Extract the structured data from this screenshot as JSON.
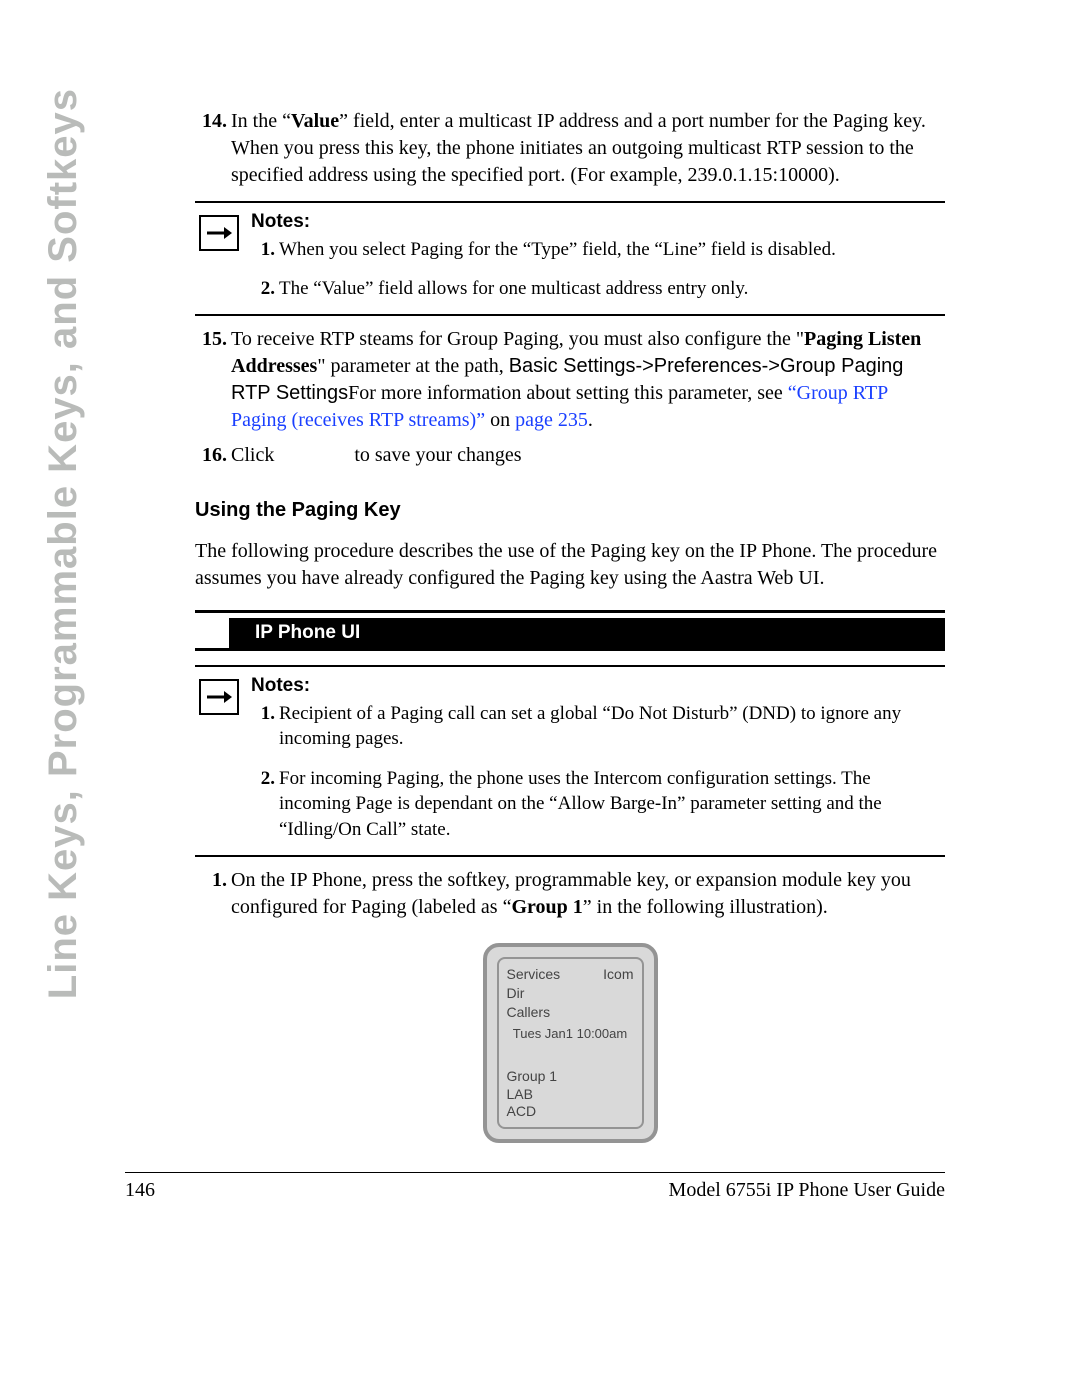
{
  "side_tab": "Line Keys, Programmable Keys, and Softkeys",
  "steps": {
    "s14": {
      "num": "14.",
      "pre": "In the “",
      "bold": "Value",
      "post": "” field, enter a multicast IP address and a port number for the Paging key. When you press this key, the phone initiates an outgoing multicast RTP session to the specified address using the specified port. (For example, 239.0.1.15:10000)."
    },
    "s15": {
      "num": "15.",
      "t1": "To receive RTP steams for Group Paging, you must also configure the \"",
      "b1": "Paging Listen Addresses",
      "t2": "\" parameter at the path, ",
      "sans": "Basic Settings->Preferences->Group Paging RTP Settings",
      "t3": "For more information about setting this parameter, see ",
      "link1": "“Group RTP Paging (receives RTP streams)”",
      "t4": " on ",
      "link2": "page 235",
      "t5": "."
    },
    "s16": {
      "num": "16.",
      "t1": "Click",
      "t2": "to save your changes"
    },
    "s1b": {
      "num": "1.",
      "t1": "On the IP Phone, press the softkey, programmable key, or expansion module key you configured for Paging (labeled as “",
      "b1": "Group 1",
      "t2": "” in the following illustration)."
    }
  },
  "notes1": {
    "title": "Notes:",
    "n1": {
      "num": "1.",
      "text": "When you select Paging for the “Type” field, the “Line” field is disabled."
    },
    "n2": {
      "num": "2.",
      "text": "The “Value” field allows for one multicast address entry only."
    }
  },
  "subhead": "Using the Paging Key",
  "para1": "The following procedure describes the use of the Paging key on the IP Phone. The procedure assumes you have already configured the Paging key using the Aastra Web UI.",
  "bar_label": "IP Phone UI",
  "notes2": {
    "title": "Notes:",
    "n1": {
      "num": "1.",
      "text": "Recipient of a Paging call can set a global “Do Not Disturb” (DND) to ignore any incoming pages."
    },
    "n2": {
      "num": "2.",
      "text": "For incoming Paging, the phone uses the Intercom configuration settings. The incoming Page is dependant on the “Allow Barge-In” parameter setting and the “Idling/On Call” state."
    }
  },
  "phone": {
    "services": "Services",
    "icom": "Icom",
    "dir": "Dir",
    "callers": "Callers",
    "date": "Tues Jan1 10:00am",
    "group1": "Group 1",
    "lab": "LAB",
    "acd": "ACD"
  },
  "footer": {
    "page": "146",
    "title": "Model 6755i IP Phone User Guide"
  }
}
